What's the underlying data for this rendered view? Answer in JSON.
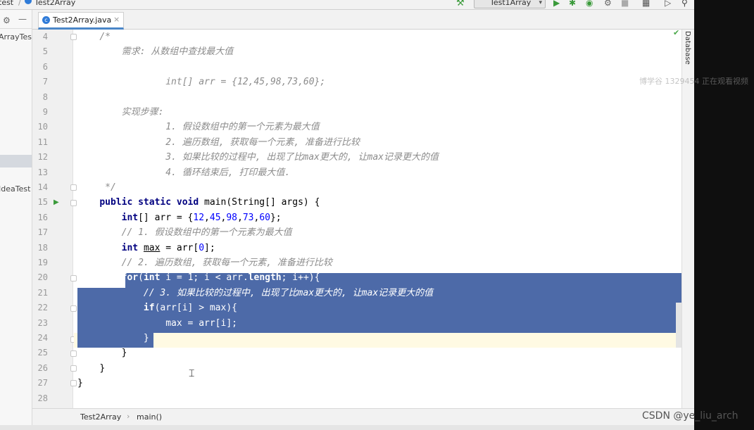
{
  "breadcrumb": {
    "project": "test",
    "separator": "/",
    "class": "Test2Array"
  },
  "toolbar": {
    "run_config": "Test1Array",
    "icons": [
      "hammer-icon",
      "run-icon",
      "debug-icon",
      "coverage-icon",
      "profile-icon",
      "stop-icon",
      "project-structure-icon",
      "presentation-icon",
      "search-icon"
    ]
  },
  "project_panel": {
    "items": [
      "ArrayTes",
      "IdeaTest"
    ]
  },
  "tabs": [
    {
      "label": "Test2Array.java",
      "close": "×",
      "active": true
    }
  ],
  "right_panel": {
    "database_label": "Database"
  },
  "editor": {
    "line_numbers": [
      "4",
      "5",
      "6",
      "7",
      "8",
      "9",
      "10",
      "11",
      "12",
      "13",
      "14",
      "15",
      "16",
      "17",
      "18",
      "19",
      "20",
      "21",
      "22",
      "23",
      "24",
      "25",
      "26",
      "27",
      "28"
    ],
    "lines": [
      {
        "indent": "    ",
        "comment": "/*"
      },
      {
        "indent": "        ",
        "comment": "需求: 从数组中查找最大值"
      },
      {
        "indent": "",
        "comment": ""
      },
      {
        "indent": "                ",
        "comment": "int[] arr = {12,45,98,73,60};"
      },
      {
        "indent": "",
        "comment": ""
      },
      {
        "indent": "        ",
        "comment": "实现步骤:"
      },
      {
        "indent": "                ",
        "comment": "1. 假设数组中的第一个元素为最大值"
      },
      {
        "indent": "                ",
        "comment": "2. 遍历数组, 获取每一个元素, 准备进行比较"
      },
      {
        "indent": "                ",
        "comment": "3. 如果比较的过程中, 出现了比max更大的, 让max记录更大的值"
      },
      {
        "indent": "                ",
        "comment": "4. 循环结束后, 打印最大值."
      },
      {
        "indent": "     ",
        "comment": "*/"
      }
    ],
    "code": {
      "l15_kw": "public static void",
      "l15_rest": " main(String[] args) {",
      "l16_kw": "int",
      "l16_a": "[] arr = {",
      "l16_n1": "12",
      "l16_n2": "45",
      "l16_n3": "98",
      "l16_n4": "73",
      "l16_n5": "60",
      "l16_end": "};",
      "l17": "// 1. 假设数组中的第一个元素为最大值",
      "l18_kw": "int",
      "l18_var": "max",
      "l18_a": " = arr[",
      "l18_n": "0",
      "l18_end": "];",
      "l19": "// 2. 遍历数组, 获取每一个元素, 准备进行比较",
      "l20_kw1": "for",
      "l20_a": "(",
      "l20_kw2": "int",
      "l20_b": " i = ",
      "l20_n": "1",
      "l20_c": "; i < arr.",
      "l20_fld": "length",
      "l20_d": "; i++){",
      "l21": "// 3. 如果比较的过程中, 出现了比max更大的, 让max记录更大的值",
      "l22_kw": "if",
      "l22_rest": "(arr[i] > max){",
      "l23": "max = arr[i];",
      "l24": "}",
      "l25": "}",
      "l26": "}",
      "l27": "}"
    }
  },
  "status": {
    "class": "Test2Array",
    "separator": "›",
    "method": "main()"
  },
  "watermarks": {
    "top": "博学谷 1329454 正在观看视频",
    "csdn": "CSDN @ye_liu_arch"
  }
}
